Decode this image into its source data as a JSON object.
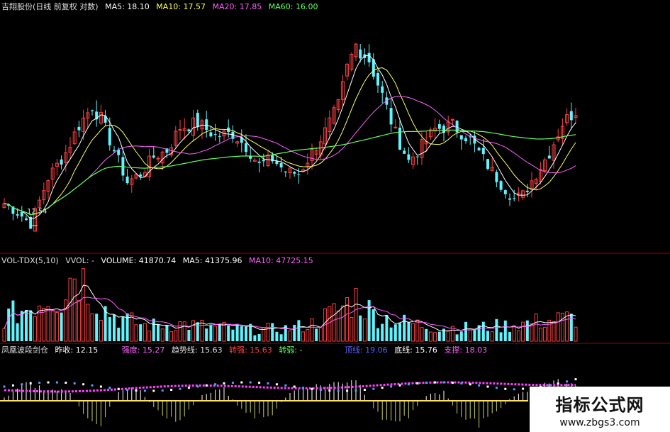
{
  "colors": {
    "up": "#ff4040",
    "down": "#5ff5ff",
    "ma5": "#ffffff",
    "ma10": "#ffff60",
    "ma20": "#ff60ff",
    "ma60": "#60ff60",
    "divider": "#a00000",
    "gold": "#ffe060",
    "magenta": "#ff40ff"
  },
  "main_header": {
    "title": "吉翔股份(日线 前复权 对数)",
    "ma5": "MA5: 18.10",
    "ma10": "MA10: 17.57",
    "ma20": "MA20: 17.85",
    "ma60": "MA60: 16.00"
  },
  "vol_header": {
    "name": "VOL-TDX(5,10)",
    "vvol": "VVOL: -",
    "volume": "VOLUME: 41870.74",
    "ma5": "MA5: 41375.96",
    "ma10": "MA10: 47725.15"
  },
  "ind_header": {
    "name": "凤凰波段剑仓",
    "prev": "昨收: 12.15",
    "strength": "强度: 15.27",
    "trend": "趋势线: 15.63",
    "weak": "转强: 15.63",
    "turn": "转弱: -",
    "top": "顶线: 19.06",
    "bottom": "底线: 15.76",
    "support": "支撑: 18.03"
  },
  "low_label": "12.54",
  "watermark": {
    "title": "指标公式网",
    "url": "www.zbgs3.com"
  },
  "chart_data": [
    {
      "type": "candlestick",
      "title": "吉翔股份(日线 前复权 对数)",
      "price_range": [
        11.8,
        22.5
      ],
      "annotations": [
        {
          "text": "12.54",
          "kind": "low"
        }
      ],
      "series_legend": [
        "MA5: 18.10",
        "MA10: 17.57",
        "MA20: 17.85",
        "MA60: 16.00"
      ],
      "anchors": [
        [
          0,
          13.6
        ],
        [
          4,
          13.0
        ],
        [
          6,
          12.6
        ],
        [
          10,
          14.8
        ],
        [
          14,
          16.0
        ],
        [
          17,
          17.3
        ],
        [
          20,
          18.2
        ],
        [
          22,
          17.6
        ],
        [
          26,
          15.6
        ],
        [
          28,
          14.6
        ],
        [
          31,
          15.0
        ],
        [
          34,
          15.8
        ],
        [
          37,
          16.1
        ],
        [
          40,
          17.2
        ],
        [
          44,
          17.4
        ],
        [
          48,
          16.8
        ],
        [
          52,
          16.9
        ],
        [
          55,
          16.3
        ],
        [
          58,
          15.4
        ],
        [
          61,
          15.7
        ],
        [
          64,
          15.1
        ],
        [
          67,
          15.0
        ],
        [
          70,
          16.0
        ],
        [
          73,
          17.0
        ],
        [
          76,
          18.2
        ],
        [
          78,
          20.0
        ],
        [
          80,
          21.1
        ],
        [
          83,
          20.4
        ],
        [
          86,
          18.7
        ],
        [
          89,
          16.9
        ],
        [
          92,
          15.6
        ],
        [
          95,
          16.3
        ],
        [
          98,
          17.1
        ],
        [
          102,
          17.3
        ],
        [
          106,
          16.6
        ],
        [
          110,
          15.4
        ],
        [
          113,
          14.5
        ],
        [
          116,
          13.8
        ],
        [
          118,
          14.0
        ],
        [
          121,
          15.0
        ],
        [
          124,
          16.0
        ],
        [
          127,
          17.4
        ],
        [
          130,
          18.0
        ]
      ]
    },
    {
      "type": "bar",
      "title": "VOL-TDX(5,10)",
      "anchors": [
        [
          0,
          0.3
        ],
        [
          6,
          0.45
        ],
        [
          10,
          0.6
        ],
        [
          13,
          0.55
        ],
        [
          16,
          0.95
        ],
        [
          19,
          0.7
        ],
        [
          22,
          0.45
        ],
        [
          26,
          0.3
        ],
        [
          32,
          0.2
        ],
        [
          40,
          0.22
        ],
        [
          48,
          0.18
        ],
        [
          56,
          0.15
        ],
        [
          64,
          0.16
        ],
        [
          70,
          0.22
        ],
        [
          76,
          0.4
        ],
        [
          80,
          0.55
        ],
        [
          84,
          0.35
        ],
        [
          90,
          0.25
        ],
        [
          98,
          0.18
        ],
        [
          106,
          0.17
        ],
        [
          114,
          0.2
        ],
        [
          120,
          0.24
        ],
        [
          126,
          0.28
        ],
        [
          130,
          0.3
        ]
      ]
    },
    {
      "type": "histogram",
      "title": "凤凰波段剑仓",
      "anchors": [
        [
          0,
          0.1
        ],
        [
          5,
          0.6
        ],
        [
          10,
          0.4
        ],
        [
          15,
          0.3
        ],
        [
          18,
          -0.5
        ],
        [
          22,
          -0.8
        ],
        [
          26,
          0.3
        ],
        [
          30,
          0.5
        ],
        [
          35,
          -0.4
        ],
        [
          40,
          -0.7
        ],
        [
          45,
          0.2
        ],
        [
          50,
          0.4
        ],
        [
          55,
          -0.5
        ],
        [
          60,
          -0.6
        ],
        [
          65,
          0.3
        ],
        [
          70,
          0.5
        ],
        [
          75,
          0.6
        ],
        [
          80,
          0.8
        ],
        [
          84,
          -0.3
        ],
        [
          88,
          -0.8
        ],
        [
          92,
          -0.5
        ],
        [
          96,
          0.2
        ],
        [
          100,
          0.3
        ],
        [
          104,
          -0.6
        ],
        [
          108,
          -0.8
        ],
        [
          112,
          -0.4
        ],
        [
          116,
          0.2
        ],
        [
          120,
          0.4
        ],
        [
          124,
          0.7
        ],
        [
          130,
          0.5
        ]
      ]
    }
  ]
}
